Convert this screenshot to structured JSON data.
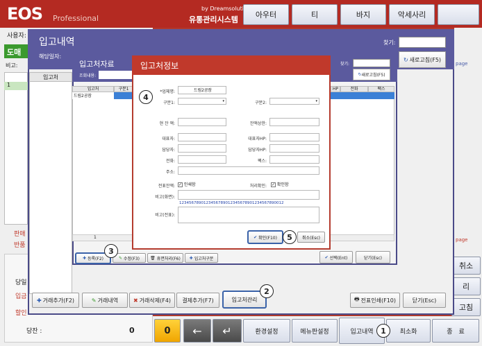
{
  "app": {
    "logo": "EOS",
    "logo_sub": "Professional",
    "by": "by Dreamsolution",
    "system": "유통관리시스템"
  },
  "categories": [
    "아우터",
    "티",
    "바지",
    "악세사리"
  ],
  "left": {
    "user_label": "사용자:",
    "green_btn": "도매",
    "note_label": "비고:",
    "row_num": "1",
    "sale_label": "판매",
    "return_label": "반품",
    "b1": "당일",
    "b2": "입금",
    "b3": "할인",
    "remaining_label": "당잔 :",
    "remaining_value": "0"
  },
  "win1": {
    "title": "입고내역",
    "date_label": "해당일자:",
    "find_label": "찾기:",
    "refresh": "새로고침(F5)",
    "col1": "입고처",
    "right_text1": "page",
    "right_text2": "page",
    "buttons": [
      "거래추가(F2)",
      "거래내역",
      "거래삭제(F4)",
      "결제추가(F7)",
      "입고처관리",
      "전표인쇄(F10)",
      "닫기(Esc)"
    ]
  },
  "win2": {
    "title": "입고처자료",
    "lookup_label": "조회내용:",
    "find_label": "찾기:",
    "refresh": "새로고침(F5)",
    "headers": [
      "입고처",
      "구분1"
    ],
    "headers_right": [
      "HP",
      "전화",
      "팩스"
    ],
    "row1": "드림2공장",
    "footer_num": "1",
    "buttons": [
      "등록(F2)",
      "수정(F3)",
      "휴면처리(F6)",
      "입고처구분"
    ],
    "select_btn": "선택(Ent)",
    "close_btn": "닫기(Esc)"
  },
  "win3": {
    "title": "입고처정보",
    "fields": {
      "company_label": "*업체명:",
      "company_value": "드림2공장",
      "cat1_label": "구분1:",
      "cat2_label": "구분2:",
      "balance_label": "현 잔 액:",
      "balance_limit_label": "잔액상한:",
      "ceo_label": "대표자:",
      "ceo_hp_label": "대표자HP:",
      "manager_label": "담당자:",
      "manager_hp_label": "담당자HP:",
      "phone_label": "전화:",
      "fax_label": "팩스:",
      "address_label": "주소:",
      "slip_label": "전표잔액:",
      "slip_check": "인쇄함",
      "process_label": "처리확인:",
      "process_check": "확인함",
      "note_screen_label": "비고(화면):",
      "note_screen_value": "1234567890123456789012345678901234567890012",
      "note_slip_label": "비고(전표):"
    },
    "ok": "확인(F10)",
    "cancel": "취소(Esc)"
  },
  "right_stub": {
    "b1": "취소",
    "b2": "리",
    "b3": "고침"
  },
  "bottom": {
    "key0": "0",
    "back": "←",
    "enter": "↵",
    "b1": "환경설정",
    "b2": "메뉴판설정",
    "b3": "입고내역",
    "b4": "최소화",
    "b5": "종　료"
  },
  "callouts": [
    "1",
    "2",
    "3",
    "4",
    "5"
  ]
}
